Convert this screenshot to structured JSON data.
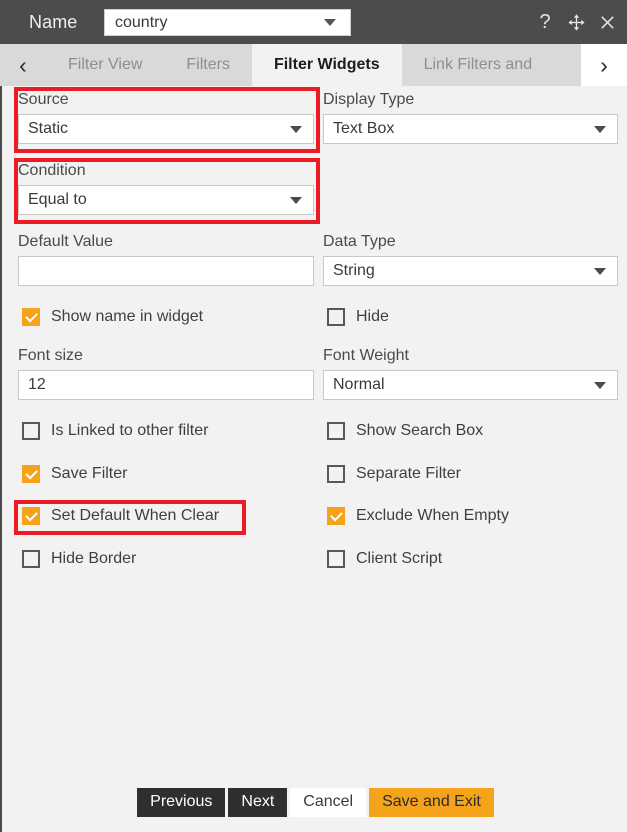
{
  "window": {
    "name_label": "Name",
    "name_value": "country",
    "icons": {
      "help": "help-icon",
      "move": "move-icon",
      "close": "close-icon"
    }
  },
  "tabs": {
    "prev_arrow": "‹",
    "next_arrow": "›",
    "items": [
      {
        "label": "Filter View",
        "active": false
      },
      {
        "label": "Filters",
        "active": false
      },
      {
        "label": "Filter Widgets",
        "active": true
      },
      {
        "label": "Link Filters and",
        "active": false
      }
    ]
  },
  "form": {
    "source": {
      "label": "Source",
      "value": "Static",
      "highlighted": true
    },
    "display_type": {
      "label": "Display Type",
      "value": "Text Box"
    },
    "condition": {
      "label": "Condition",
      "value": "Equal to",
      "highlighted": true
    },
    "default_value": {
      "label": "Default Value",
      "value": "",
      "placeholder": ""
    },
    "data_type": {
      "label": "Data Type",
      "value": "String"
    },
    "font_size": {
      "label": "Font size",
      "value": "12"
    },
    "font_weight": {
      "label": "Font Weight",
      "value": "Normal"
    },
    "checkboxes": {
      "show_name_in_widget": {
        "label": "Show name in widget",
        "checked": true
      },
      "hide": {
        "label": "Hide",
        "checked": false
      },
      "is_linked_to_other_filter": {
        "label": "Is Linked to other filter",
        "checked": false
      },
      "show_search_box": {
        "label": "Show Search Box",
        "checked": false
      },
      "save_filter": {
        "label": "Save Filter",
        "checked": true
      },
      "separate_filter": {
        "label": "Separate Filter",
        "checked": false
      },
      "set_default_when_clear": {
        "label": "Set Default When Clear",
        "checked": true,
        "highlighted": true
      },
      "exclude_when_empty": {
        "label": "Exclude When Empty",
        "checked": true
      },
      "hide_border": {
        "label": "Hide Border",
        "checked": false
      },
      "client_script": {
        "label": "Client Script",
        "checked": false
      }
    }
  },
  "footer": {
    "previous": "Previous",
    "next": "Next",
    "cancel": "Cancel",
    "save_and_exit": "Save and Exit"
  },
  "colors": {
    "titlebar": "#4c4c4c",
    "panel": "#f2f2f2",
    "tabstrip": "#d9d9d9",
    "accent": "#f5a31a",
    "highlight": "#ec1c24",
    "button_dark": "#2f2f2f"
  }
}
